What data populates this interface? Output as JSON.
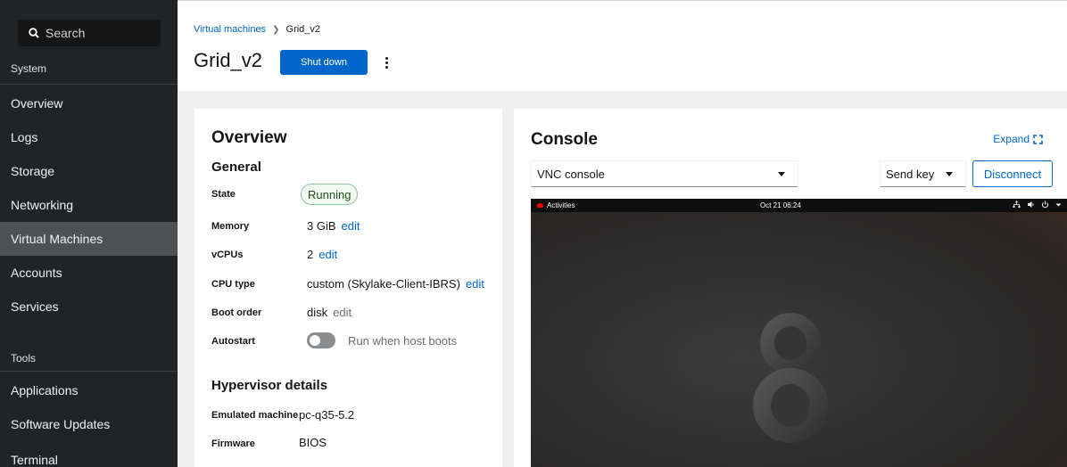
{
  "sidebar": {
    "search_label": "Search",
    "groups": [
      {
        "title": "System"
      },
      {
        "title": "Tools"
      }
    ],
    "items": [
      {
        "label": "Overview"
      },
      {
        "label": "Logs"
      },
      {
        "label": "Storage"
      },
      {
        "label": "Networking"
      },
      {
        "label": "Virtual Machines"
      },
      {
        "label": "Accounts"
      },
      {
        "label": "Services"
      },
      {
        "label": "Applications"
      },
      {
        "label": "Software Updates"
      },
      {
        "label": "Terminal"
      }
    ],
    "active_item": "Virtual Machines"
  },
  "header": {
    "breadcrumb": [
      "Virtual machines",
      "Grid_v2"
    ],
    "title": "Grid_v2",
    "shutdown_label": "Shut down"
  },
  "overview": {
    "title": "Overview",
    "general_title": "General",
    "rows": [
      {
        "term": "State",
        "value": "Running"
      },
      {
        "term": "Memory",
        "value": "3 GiB",
        "action": "edit"
      },
      {
        "term": "vCPUs",
        "value": "2",
        "action": "edit"
      },
      {
        "term": "CPU type",
        "value": "custom (Skylake-Client-IBRS)",
        "action": "edit"
      },
      {
        "term": "Boot order",
        "value": "disk",
        "action": "edit"
      },
      {
        "term": "Autostart",
        "value": "Run when host boots"
      }
    ],
    "hypervisor_title": "Hypervisor details",
    "hypervisor_rows": [
      {
        "term": "Emulated machine",
        "value": "pc-q35-5.2"
      },
      {
        "term": "Firmware",
        "value": "BIOS"
      }
    ]
  },
  "console": {
    "title": "Console",
    "expand_label": "Expand",
    "console_type": "VNC console",
    "sendkey_label": "Send key",
    "disconnect_label": "Disconnect",
    "vnc": {
      "activities": "Activities",
      "clock": "Oct 21 06:24",
      "tray": [
        "network-icon",
        "volume-icon",
        "power-icon",
        "chevron-down-icon"
      ]
    }
  },
  "colors": {
    "primary": "#0066cc",
    "sidebar_bg": "#212427",
    "running_green": "#1e4f18"
  }
}
